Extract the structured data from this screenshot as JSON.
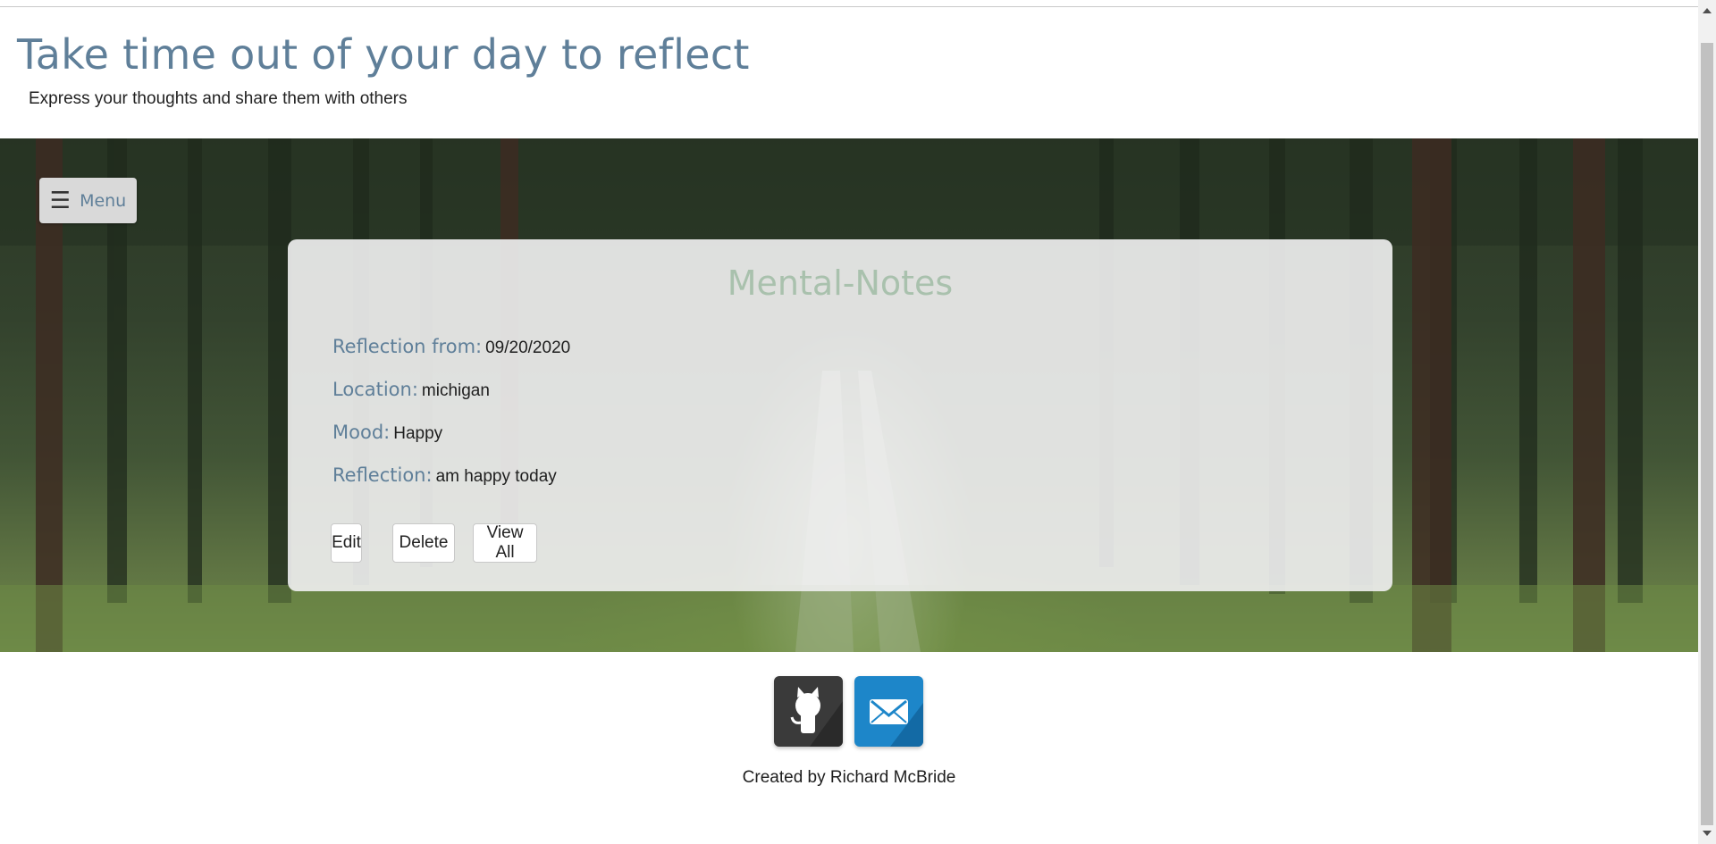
{
  "header": {
    "title": "Take time out of your day to reflect",
    "subtitle": "Express your thoughts and share them with others"
  },
  "menu": {
    "icon": "hamburger-icon",
    "label": "Menu"
  },
  "note": {
    "app_name": "Mental-Notes",
    "fields": [
      {
        "label": "Reflection from:",
        "value": "09/20/2020"
      },
      {
        "label": "Location:",
        "value": "michigan"
      },
      {
        "label": "Mood:",
        "value": "Happy"
      },
      {
        "label": "Reflection:",
        "value": "am happy today"
      }
    ],
    "actions": {
      "edit": "Edit",
      "delete": "Delete",
      "view_all": "View All"
    }
  },
  "footer": {
    "social": [
      {
        "icon": "github-icon"
      },
      {
        "icon": "mail-icon"
      }
    ],
    "credit": "Created by Richard McBride"
  },
  "colors": {
    "accent": "#5f7f99",
    "card_title": "#a9c1ad",
    "github_bg": "#3a3a3a",
    "mail_bg": "#1d86c9"
  }
}
